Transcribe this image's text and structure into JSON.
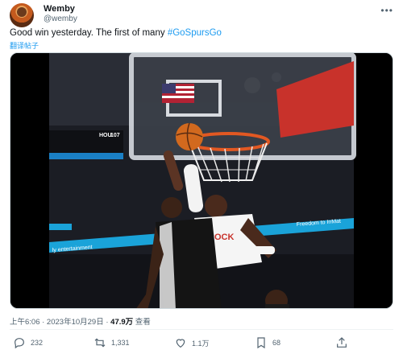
{
  "user": {
    "name": "Wemby",
    "handle": "@wemby"
  },
  "tweet": {
    "text": "Good win yesterday. The first of many ",
    "hashtag": "#GoSpursGo",
    "translate": "翻译帖子"
  },
  "media": {
    "scoreboard_team": "HOU",
    "scoreboard_score": "107",
    "banner_text": "Freedom to InMat",
    "banner_text_left": "Freedom to InMat",
    "banner_text_lower": "ly entertainment",
    "jersey_text": "ROCK"
  },
  "meta": {
    "time": "上午6:06 · 2023年10月29日 · ",
    "views": "47.9万",
    "views_label": " 查看"
  },
  "actions": {
    "reply_count": "232",
    "retweet_count": "1,331",
    "like_count": "1.1万",
    "bookmark_count": "68"
  },
  "colors": {
    "accent": "#1d9bf0",
    "muted": "#536471"
  }
}
